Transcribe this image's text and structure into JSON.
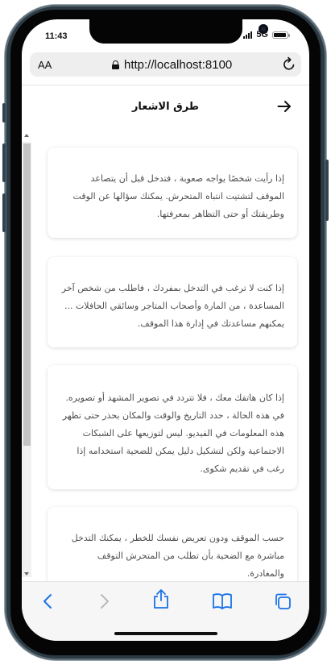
{
  "status_bar": {
    "time": "11:43",
    "network": "5G"
  },
  "browser": {
    "text_size_label": "AA",
    "url": "http://localhost:8100"
  },
  "page": {
    "title": "طرق الاشعار",
    "cards": [
      {
        "text": "إذا رأيت شخصًا يواجه صعوبة ، فتدخل قبل أن يتصاعد الموقف لتشتيت انتباه المتحرش. يمكنك سؤالها عن الوقت وطريقتك أو حتى التظاهر بمعرفتها."
      },
      {
        "text": "إذا كنت لا ترغب في التدخل بمفردك ، فاطلب من شخص آخر المساعدة ، من المارة وأصحاب المتاجر وسائقي الحافلات ... يمكنهم مساعدتك في إدارة هذا الموقف."
      },
      {
        "text": "إذا كان هاتفك معك ، فلا تتردد في تصوير المشهد أو تصويره. في هذه الحالة ، حدد التاريخ والوقت والمكان بحذر حتى تظهر هذه المعلومات في الفيديو. ليس لتوزيعها على الشبكات الاجتماعية ولكن لتشكيل دليل يمكن للضحية استخدامه إذا رغب في تقديم شكوى."
      },
      {
        "text": "حسب الموقف ودون تعريض نفسك للخطر ، يمكنك التدخل مباشرة مع الضحية بأن تطلب من المتحرش التوقف والمغادرة."
      }
    ]
  },
  "icons": {
    "back": "arrow-right-icon",
    "reload": "reload-icon",
    "nav_back": "chevron-left-icon",
    "nav_forward": "chevron-right-icon",
    "share": "share-icon",
    "bookmarks": "book-icon",
    "tabs": "tabs-icon"
  },
  "colors": {
    "accent": "#1a73e8",
    "card_text": "#4e4e4e"
  }
}
